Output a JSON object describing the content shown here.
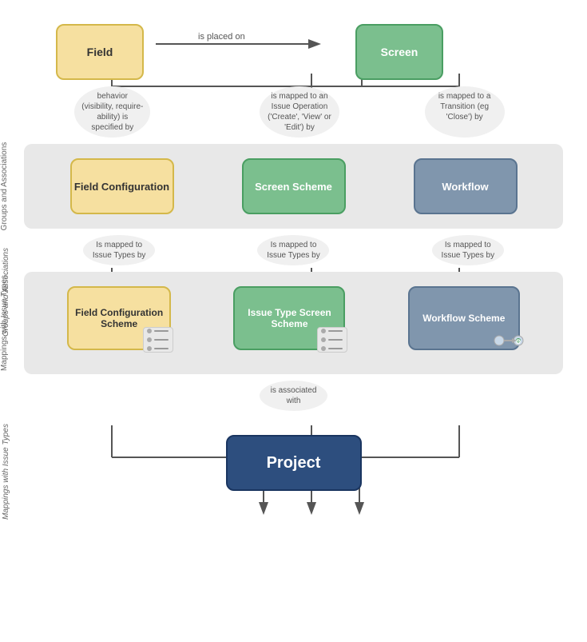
{
  "nodes": {
    "field": "Field",
    "screen": "Screen",
    "field_config": "Field Configuration",
    "screen_scheme": "Screen Scheme",
    "workflow": "Workflow",
    "field_config_scheme": "Field Configuration Scheme",
    "issue_type_screen_scheme": "Issue Type Screen Scheme",
    "workflow_scheme": "Workflow Scheme",
    "project": "Project"
  },
  "arrows": {
    "field_to_screen": "is placed on",
    "behavior_label": "behavior (visibility, require-ability) is specified by",
    "mapped_operation_label": "is mapped to an Issue Operation ('Create', 'View' or 'Edit') by",
    "mapped_transition_label": "is mapped to a Transition (eg 'Close') by",
    "mapped_issue_fc": "Is mapped to Issue Types by",
    "mapped_issue_ss": "Is mapped to Issue Types by",
    "mapped_issue_wf": "Is mapped to Issue Types by",
    "associated_with": "is associated with"
  },
  "section_labels": {
    "groups": "Groups and Associations",
    "mappings": "Mappings with Issue Types"
  }
}
